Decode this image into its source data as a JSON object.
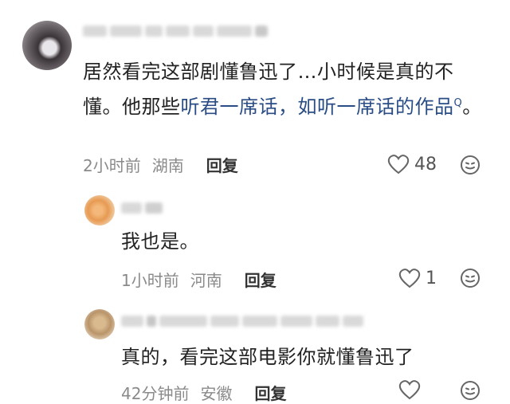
{
  "comments": [
    {
      "text_before_link": "居然看完这部剧懂鲁迅了…小时候是真的不懂。他那些",
      "link_text": "听君一席话，如听一席话的作品",
      "link_sup": "Q",
      "text_after_link": "。",
      "time": "2小时前",
      "location": "湖南",
      "reply_label": "回复",
      "likes": "48"
    },
    {
      "text": "我也是。",
      "time": "1小时前",
      "location": "河南",
      "reply_label": "回复",
      "likes": "1"
    },
    {
      "text": "真的，看完这部电影你就懂鲁迅了",
      "time": "42分钟前",
      "location": "安徽",
      "reply_label": "回复",
      "likes": ""
    }
  ],
  "colors": {
    "link": "#2a4d86",
    "meta": "#8a8a8a"
  },
  "icons": [
    "heart-icon",
    "emoji-reaction-icon"
  ]
}
